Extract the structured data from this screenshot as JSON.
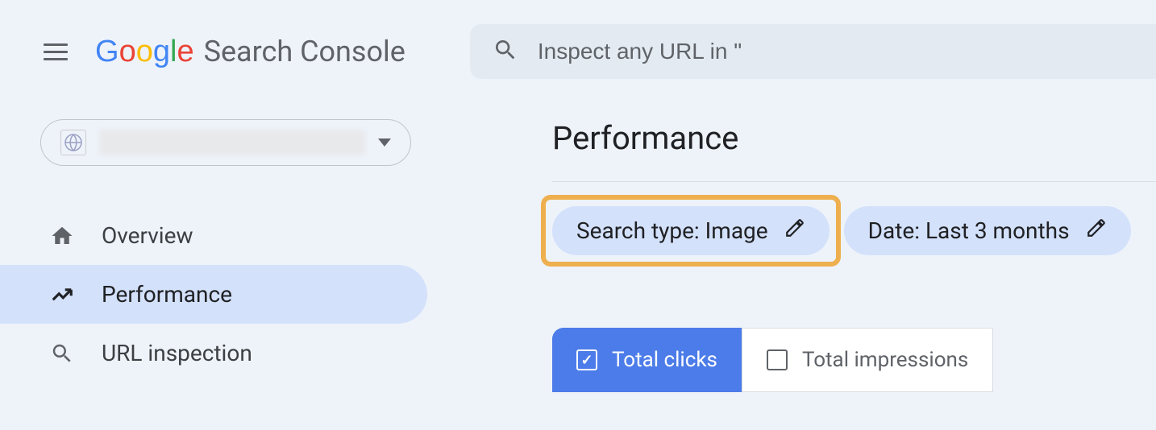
{
  "header": {
    "product_name": "Search Console",
    "search_placeholder": "Inspect any URL in \""
  },
  "sidebar": {
    "items": [
      {
        "label": "Overview",
        "icon": "home"
      },
      {
        "label": "Performance",
        "icon": "trend"
      },
      {
        "label": "URL inspection",
        "icon": "search"
      }
    ]
  },
  "main": {
    "title": "Performance",
    "filter_chips": [
      {
        "label": "Search type: Image"
      },
      {
        "label": "Date: Last 3 months"
      }
    ],
    "metrics": [
      {
        "label": "Total clicks",
        "checked": true
      },
      {
        "label": "Total impressions",
        "checked": false
      }
    ]
  }
}
